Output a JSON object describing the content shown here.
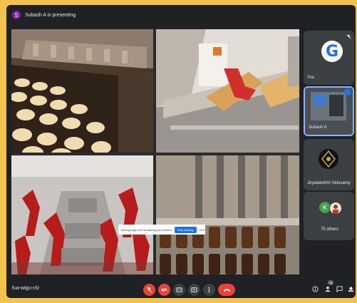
{
  "presenter": {
    "initial": "S",
    "text": "Subash A is presenting"
  },
  "participants": {
    "you": {
      "label": "You",
      "avatar_letter": "G"
    },
    "presenter_tile": {
      "label": "Subash A"
    },
    "tile3": {
      "label": "Jeyalakshmi Velusamy"
    },
    "others": {
      "label": "75 others",
      "avatar_letter": "K"
    }
  },
  "popup": {
    "message": "meet.google.com is sharing your screen.",
    "stop_label": "Stop sharing",
    "hide_label": "Hide"
  },
  "meeting": {
    "code": "fua-wtgu-cfz",
    "people_count": "78"
  },
  "colors": {
    "accent": "#8ab4f8",
    "end_call": "#ea4335",
    "frame_bg": "#202124",
    "outer_bg": "#f2c14e"
  }
}
